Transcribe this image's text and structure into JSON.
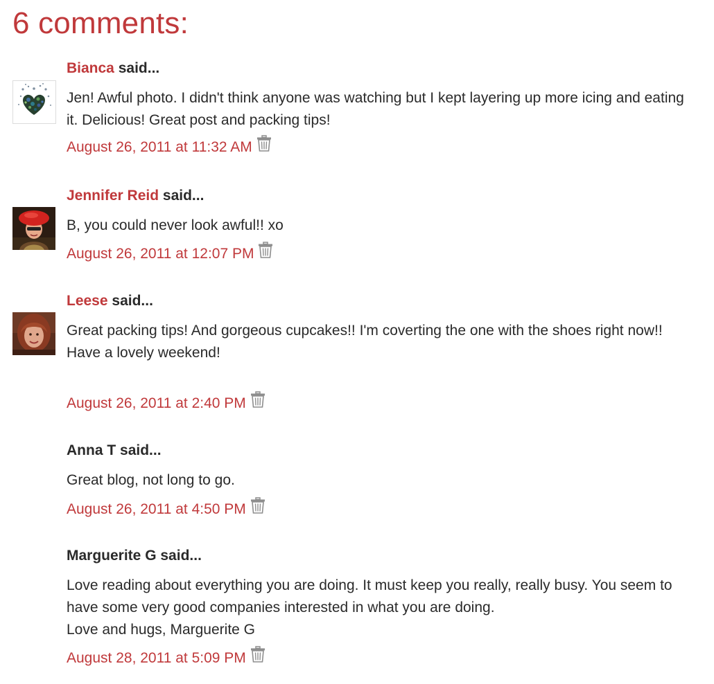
{
  "comments_heading": "6 comments:",
  "said_label": "said...",
  "colors": {
    "accent": "#c0393b",
    "text": "#2a2a2a",
    "icon": "#8e8e8e"
  },
  "comments": [
    {
      "author": "Bianca",
      "author_linked": true,
      "avatar": "heart-collage-avatar",
      "lines": [
        "Jen! Awful photo. I didn't think anyone was watching but I kept layering up more icing and eating it. Delicious! Great post and packing tips!"
      ],
      "timestamp": "August 26, 2011 at 11:32 AM"
    },
    {
      "author": "Jennifer Reid",
      "author_linked": true,
      "avatar": "red-beret-woman-avatar",
      "lines": [
        "B, you could never look awful!! xo"
      ],
      "timestamp": "August 26, 2011 at 12:07 PM"
    },
    {
      "author": "Leese",
      "author_linked": true,
      "avatar": "red-haired-woman-avatar",
      "lines": [
        "Great packing tips! And gorgeous cupcakes!! I'm coverting the one with the shoes right now!!",
        "Have a lovely weekend!"
      ],
      "timestamp": "August 26, 2011 at 2:40 PM"
    },
    {
      "author": "Anna T",
      "author_linked": false,
      "avatar": "",
      "lines": [
        "Great blog, not long to go."
      ],
      "timestamp": "August 26, 2011 at 4:50 PM"
    },
    {
      "author": "Marguerite G",
      "author_linked": false,
      "avatar": "",
      "lines": [
        "Love reading about everything you are doing. It must keep you really, really busy. You seem to have some very good companies interested in what you are doing.",
        "Love and hugs, Marguerite G"
      ],
      "timestamp": "August 28, 2011 at 5:09 PM"
    }
  ]
}
